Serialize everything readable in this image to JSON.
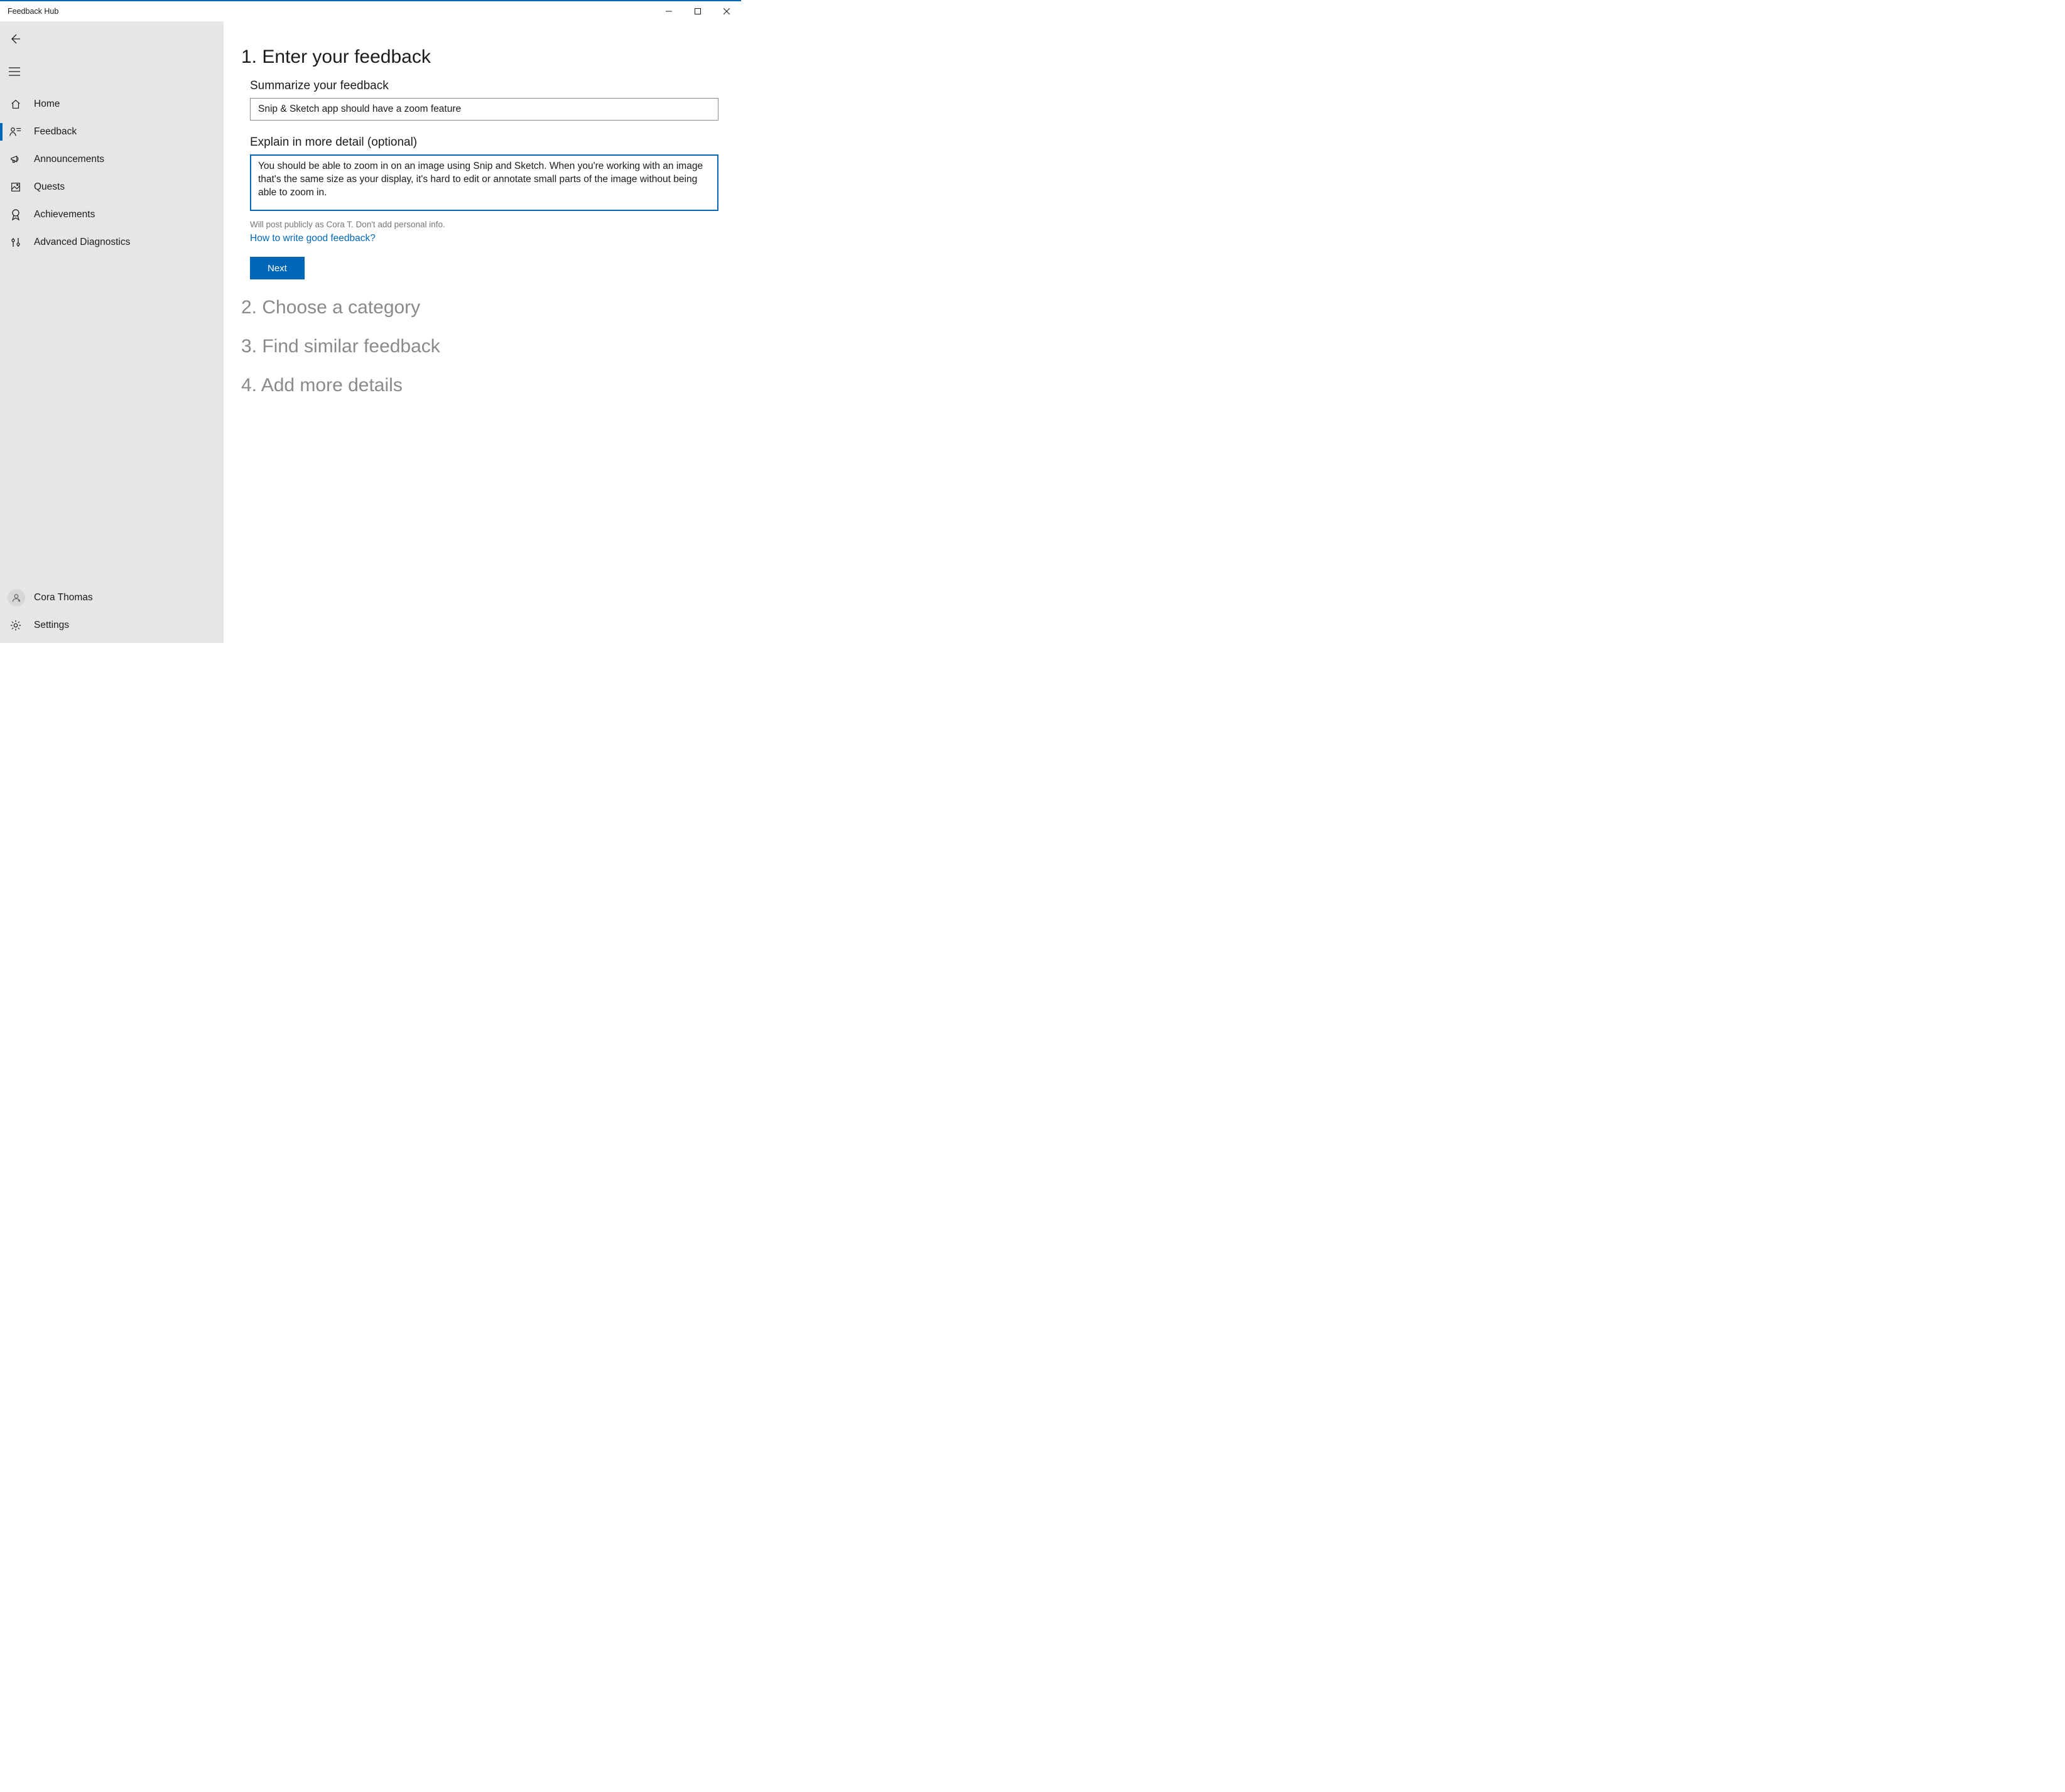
{
  "window": {
    "title": "Feedback Hub"
  },
  "sidebar": {
    "items": [
      {
        "label": "Home"
      },
      {
        "label": "Feedback"
      },
      {
        "label": "Announcements"
      },
      {
        "label": "Quests"
      },
      {
        "label": "Achievements"
      },
      {
        "label": "Advanced Diagnostics"
      }
    ],
    "user": {
      "name": "Cora Thomas"
    },
    "settings_label": "Settings"
  },
  "main": {
    "step1_title": "1. Enter your feedback",
    "summary_label": "Summarize your feedback",
    "summary_value": "Snip & Sketch app should have a zoom feature",
    "detail_label": "Explain in more detail (optional)",
    "detail_value": "You should be able to zoom in on an image using Snip and Sketch. When you're working with an image that's the same size as your display, it's hard to edit or annotate small parts of the image without being able to zoom in.",
    "publish_hint": "Will post publicly as Cora T. Don't add personal info.",
    "help_link": "How to write good feedback?",
    "next_label": "Next",
    "step2_title": "2. Choose a category",
    "step3_title": "3. Find similar feedback",
    "step4_title": "4. Add more details"
  }
}
